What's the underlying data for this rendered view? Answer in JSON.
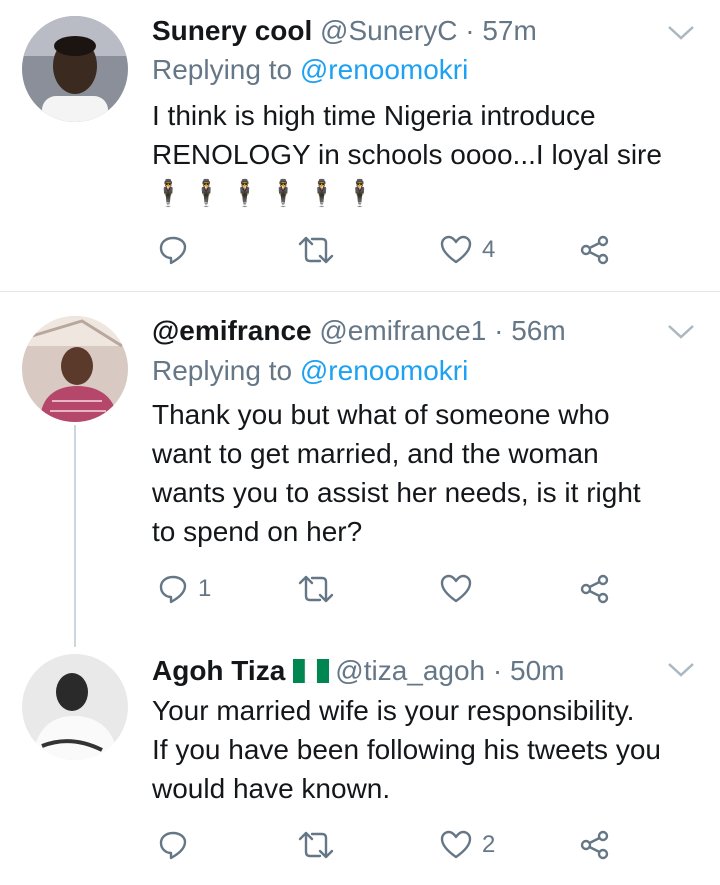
{
  "tweets": [
    {
      "name": "Sunery cool",
      "handle": "@SuneryC",
      "time": "57m",
      "replying_prefix": "Replying to",
      "replying_to": "@renoomokri",
      "body": [
        "I think is high time Nigeria introduce",
        "RENOLOGY in schools oooo...I loyal sire",
        "🕴️🕴️🕴️🕴️🕴️🕴️"
      ],
      "replies": "",
      "likes": "4"
    },
    {
      "name": "@emifrance",
      "handle": "@emifrance1",
      "time": "56m",
      "replying_prefix": "Replying to",
      "replying_to": "@renoomokri",
      "body": [
        "Thank you but what of someone who",
        "want to get married, and the woman",
        "wants you to assist her needs, is it right",
        "to spend on her?"
      ],
      "replies": "1",
      "likes": ""
    },
    {
      "name": "Agoh Tiza",
      "handle": "@tiza_agoh",
      "time": "50m",
      "flag": "nigeria-flag-icon",
      "body": [
        "Your married wife is your responsibility.",
        "If you have been following his tweets you",
        "would have known."
      ],
      "replies": "",
      "likes": "2"
    }
  ],
  "separator": "·",
  "colors": {
    "text": "#14171a",
    "muted": "#657786",
    "link": "#1da1f2",
    "divider": "#e1e8ed"
  }
}
